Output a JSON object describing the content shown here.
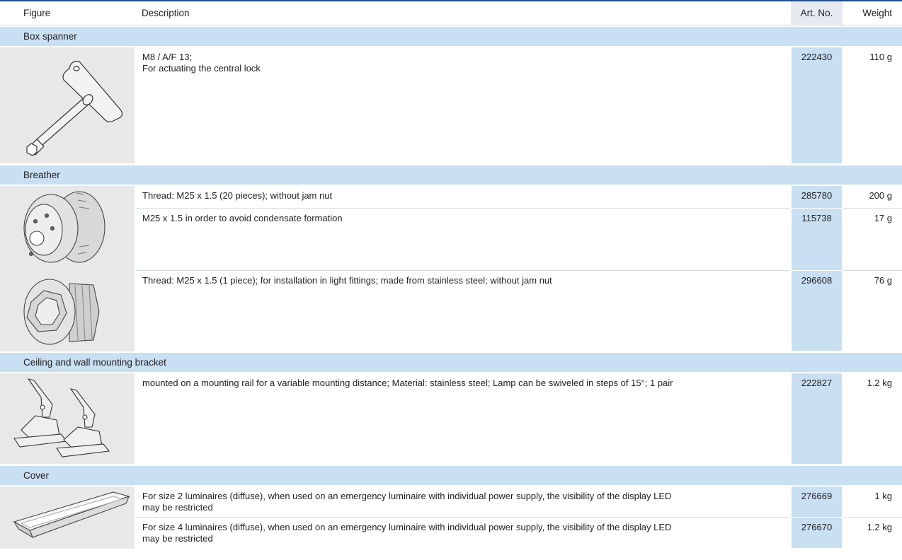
{
  "header": {
    "figure": "Figure",
    "description": "Description",
    "art_no": "Art. No.",
    "weight": "Weight"
  },
  "groups": [
    {
      "title": "Box spanner",
      "rows": [
        {
          "icon": "box-spanner-icon",
          "desc_lines": [
            "M8 / A/F 13;",
            "For actuating the central lock"
          ],
          "art": "222430",
          "weight": "110 g"
        }
      ]
    },
    {
      "title": "Breather",
      "rows": [
        {
          "icon": "breather-icon",
          "desc_lines": [
            "Thread: M25 x 1.5 (20 pieces); without jam nut"
          ],
          "art": "285780",
          "weight": "200 g"
        },
        {
          "icon": "",
          "desc_lines": [
            "M25 x 1.5 in order to avoid condensate formation"
          ],
          "art": "115738",
          "weight": "17 g"
        },
        {
          "icon": "hex-breather-icon",
          "desc_lines": [
            "Thread: M25 x 1.5 (1 piece); for installation in light fittings; made from stainless steel; without jam nut"
          ],
          "art": "296608",
          "weight": "76 g"
        }
      ]
    },
    {
      "title": "Ceiling and wall mounting bracket",
      "rows": [
        {
          "icon": "mounting-bracket-icon",
          "desc_lines": [
            "mounted on a mounting rail for a variable mounting distance; Material: stainless steel; Lamp can be swiveled in steps of 15°; 1 pair"
          ],
          "art": "222827",
          "weight": "1.2 kg"
        }
      ]
    },
    {
      "title": "Cover",
      "rows": [
        {
          "icon": "cover-tray-icon",
          "desc_lines": [
            "For size 2 luminaires (diffuse), when used on an emergency luminaire with individual power supply, the visibility of the display LED",
            "may be restricted"
          ],
          "art": "276669",
          "weight": "1 kg"
        },
        {
          "icon": "",
          "desc_lines": [
            "For size 4 luminaires (diffuse), when used on an emergency luminaire with individual power supply, the visibility of the display LED",
            "may be restricted"
          ],
          "art": "276670",
          "weight": "1.2 kg"
        }
      ]
    }
  ]
}
